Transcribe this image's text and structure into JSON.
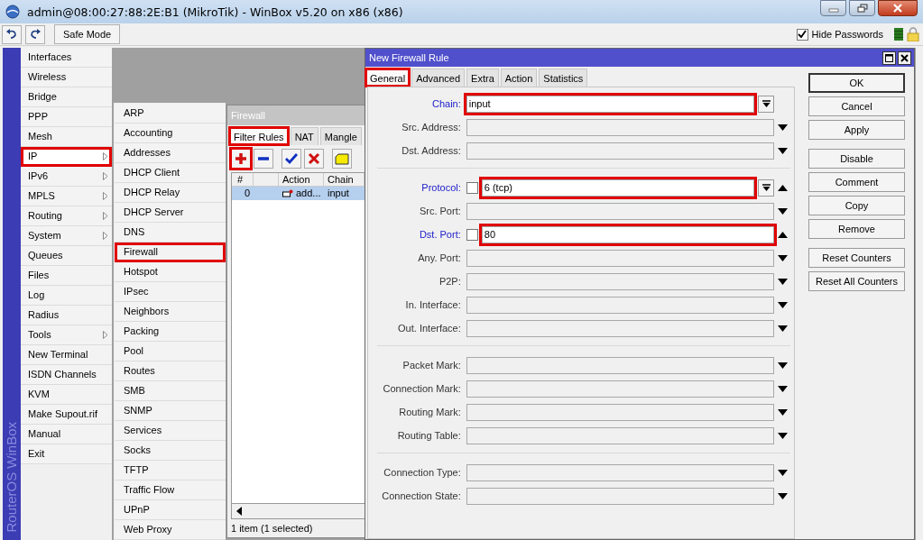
{
  "window": {
    "title": "admin@08:00:27:88:2E:B1 (MikroTik) - WinBox v5.20 on x86 (x86)"
  },
  "toolbar": {
    "safe_mode": "Safe Mode",
    "hide_passwords": {
      "label": "Hide Passwords",
      "checked": true
    }
  },
  "sidebar": {
    "brand": "RouterOS WinBox",
    "items": [
      {
        "label": "Interfaces",
        "submenu": false,
        "selected": false,
        "highlighted": false
      },
      {
        "label": "Wireless",
        "submenu": false,
        "selected": false,
        "highlighted": false
      },
      {
        "label": "Bridge",
        "submenu": false,
        "selected": false,
        "highlighted": false
      },
      {
        "label": "PPP",
        "submenu": false,
        "selected": false,
        "highlighted": false
      },
      {
        "label": "Mesh",
        "submenu": false,
        "selected": false,
        "highlighted": false
      },
      {
        "label": "IP",
        "submenu": true,
        "selected": true,
        "highlighted": true
      },
      {
        "label": "IPv6",
        "submenu": true,
        "selected": false,
        "highlighted": false
      },
      {
        "label": "MPLS",
        "submenu": true,
        "selected": false,
        "highlighted": false
      },
      {
        "label": "Routing",
        "submenu": true,
        "selected": false,
        "highlighted": false
      },
      {
        "label": "System",
        "submenu": true,
        "selected": false,
        "highlighted": false
      },
      {
        "label": "Queues",
        "submenu": false,
        "selected": false,
        "highlighted": false
      },
      {
        "label": "Files",
        "submenu": false,
        "selected": false,
        "highlighted": false
      },
      {
        "label": "Log",
        "submenu": false,
        "selected": false,
        "highlighted": false
      },
      {
        "label": "Radius",
        "submenu": false,
        "selected": false,
        "highlighted": false
      },
      {
        "label": "Tools",
        "submenu": true,
        "selected": false,
        "highlighted": false
      },
      {
        "label": "New Terminal",
        "submenu": false,
        "selected": false,
        "highlighted": false
      },
      {
        "label": "ISDN Channels",
        "submenu": false,
        "selected": false,
        "highlighted": false
      },
      {
        "label": "KVM",
        "submenu": false,
        "selected": false,
        "highlighted": false
      },
      {
        "label": "Make Supout.rif",
        "submenu": false,
        "selected": false,
        "highlighted": false
      },
      {
        "label": "Manual",
        "submenu": false,
        "selected": false,
        "highlighted": false
      },
      {
        "label": "Exit",
        "submenu": false,
        "selected": false,
        "highlighted": false
      }
    ]
  },
  "submenu": {
    "items": [
      {
        "label": "ARP",
        "highlighted": false
      },
      {
        "label": "Accounting",
        "highlighted": false
      },
      {
        "label": "Addresses",
        "highlighted": false
      },
      {
        "label": "DHCP Client",
        "highlighted": false
      },
      {
        "label": "DHCP Relay",
        "highlighted": false
      },
      {
        "label": "DHCP Server",
        "highlighted": false
      },
      {
        "label": "DNS",
        "highlighted": false
      },
      {
        "label": "Firewall",
        "highlighted": true
      },
      {
        "label": "Hotspot",
        "highlighted": false
      },
      {
        "label": "IPsec",
        "highlighted": false
      },
      {
        "label": "Neighbors",
        "highlighted": false
      },
      {
        "label": "Packing",
        "highlighted": false
      },
      {
        "label": "Pool",
        "highlighted": false
      },
      {
        "label": "Routes",
        "highlighted": false
      },
      {
        "label": "SMB",
        "highlighted": false
      },
      {
        "label": "SNMP",
        "highlighted": false
      },
      {
        "label": "Services",
        "highlighted": false
      },
      {
        "label": "Socks",
        "highlighted": false
      },
      {
        "label": "TFTP",
        "highlighted": false
      },
      {
        "label": "Traffic Flow",
        "highlighted": false
      },
      {
        "label": "UPnP",
        "highlighted": false
      },
      {
        "label": "Web Proxy",
        "highlighted": false
      }
    ]
  },
  "firewall": {
    "title": "Firewall",
    "tabs": [
      {
        "label": "Filter Rules",
        "selected": true,
        "highlighted": true
      },
      {
        "label": "NAT",
        "selected": false,
        "highlighted": false
      },
      {
        "label": "Mangle",
        "selected": false,
        "highlighted": false
      }
    ],
    "tools": [
      {
        "kind": "add",
        "highlighted": true
      },
      {
        "kind": "remove",
        "highlighted": false
      },
      {
        "kind": "enable",
        "highlighted": false
      },
      {
        "kind": "disable",
        "highlighted": false
      },
      {
        "kind": "comment",
        "highlighted": false
      }
    ],
    "columns": [
      "#",
      "Action",
      "Chain"
    ],
    "rows": [
      {
        "number": "0",
        "action": "add...",
        "chain": "input",
        "selected": true
      }
    ],
    "status": "1 item (1 selected)"
  },
  "rule_window": {
    "title": "New Firewall Rule",
    "tabs": [
      {
        "label": "General",
        "selected": true,
        "highlighted": true
      },
      {
        "label": "Advanced",
        "selected": false,
        "highlighted": false
      },
      {
        "label": "Extra",
        "selected": false,
        "highlighted": false
      },
      {
        "label": "Action",
        "selected": false,
        "highlighted": false
      },
      {
        "label": "Statistics",
        "selected": false,
        "highlighted": false
      }
    ],
    "sections": [
      [
        {
          "kind": "fixed",
          "label": "Chain:",
          "set": true,
          "value": "input",
          "highlighted": true,
          "drop_button": true
        },
        {
          "kind": "dropdown",
          "label": "Src. Address:",
          "set": false,
          "highlighted": false,
          "drop_button": false
        },
        {
          "kind": "dropdown",
          "label": "Dst. Address:",
          "set": false,
          "highlighted": false,
          "drop_button": false
        }
      ],
      [
        {
          "kind": "expanded",
          "label": "Protocol:",
          "set": true,
          "negated": false,
          "value": "6 (tcp)",
          "highlighted": true,
          "drop_button": true
        },
        {
          "kind": "dropdown",
          "label": "Src. Port:",
          "set": false,
          "highlighted": false,
          "drop_button": false
        },
        {
          "kind": "expanded",
          "label": "Dst. Port:",
          "set": true,
          "negated": false,
          "value": "80",
          "highlighted": true,
          "drop_button": false
        },
        {
          "kind": "dropdown",
          "label": "Any. Port:",
          "set": false,
          "highlighted": false,
          "drop_button": false
        },
        {
          "kind": "dropdown",
          "label": "P2P:",
          "set": false,
          "highlighted": false,
          "drop_button": false
        },
        {
          "kind": "dropdown",
          "label": "In. Interface:",
          "set": false,
          "highlighted": false,
          "drop_button": false
        },
        {
          "kind": "dropdown",
          "label": "Out. Interface:",
          "set": false,
          "highlighted": false,
          "drop_button": false
        }
      ],
      [
        {
          "kind": "dropdown",
          "label": "Packet Mark:",
          "set": false,
          "highlighted": false,
          "drop_button": false
        },
        {
          "kind": "dropdown",
          "label": "Connection Mark:",
          "set": false,
          "highlighted": false,
          "drop_button": false
        },
        {
          "kind": "dropdown",
          "label": "Routing Mark:",
          "set": false,
          "highlighted": false,
          "drop_button": false
        },
        {
          "kind": "dropdown",
          "label": "Routing Table:",
          "set": false,
          "highlighted": false,
          "drop_button": false
        }
      ],
      [
        {
          "kind": "dropdown",
          "label": "Connection Type:",
          "set": false,
          "highlighted": false,
          "drop_button": false
        },
        {
          "kind": "dropdown",
          "label": "Connection State:",
          "set": false,
          "highlighted": false,
          "drop_button": false
        }
      ]
    ],
    "buttons": [
      [
        {
          "label": "OK",
          "default": true
        },
        {
          "label": "Cancel",
          "default": false
        },
        {
          "label": "Apply",
          "default": false
        }
      ],
      [
        {
          "label": "Disable",
          "default": false
        },
        {
          "label": "Comment",
          "default": false
        },
        {
          "label": "Copy",
          "default": false
        },
        {
          "label": "Remove",
          "default": false
        }
      ],
      [
        {
          "label": "Reset Counters",
          "default": false
        },
        {
          "label": "Reset All Counters",
          "default": false
        }
      ]
    ]
  }
}
